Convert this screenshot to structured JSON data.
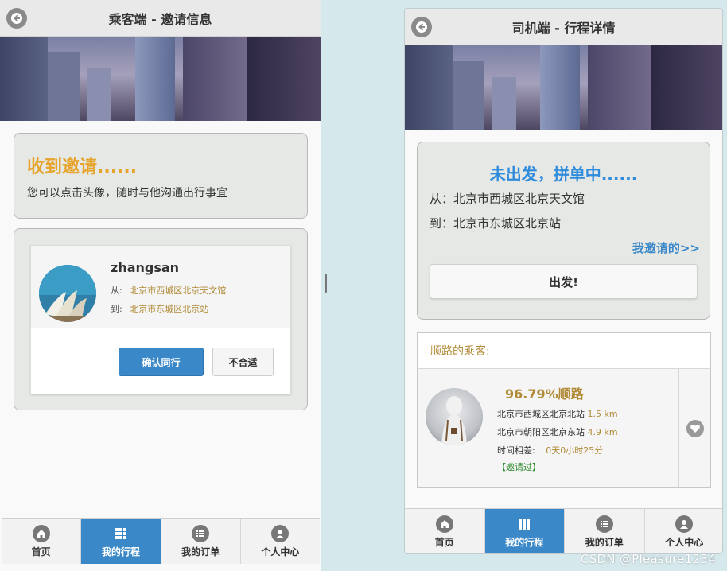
{
  "left": {
    "title": "乘客端 - 邀请信息",
    "invite_title": "收到邀请......",
    "invite_sub": "您可以点击头像，随时与他沟通出行事宜",
    "user": {
      "name": "zhangsan",
      "from_label": "从:",
      "from_addr": "北京市西城区北京天文馆",
      "to_label": "到:",
      "to_addr": "北京市东城区北京站"
    },
    "confirm_btn": "确认同行",
    "reject_btn": "不合适"
  },
  "right": {
    "title": "司机端 - 行程详情",
    "status": "未出发，拼单中......",
    "from": "从：北京市西城区北京天文馆",
    "to": "到：北京市东城区北京站",
    "invited_link": "我邀请的>>",
    "depart_btn": "出发!",
    "passengers_header": "顺路的乘客:",
    "passenger": {
      "match": "96.79%顺路",
      "from_addr": "北京市西城区北京北站",
      "from_dist": "1.5 km",
      "to_addr": "北京市朝阳区北京东站",
      "to_dist": "4.9 km",
      "time_label": "时间相差:",
      "time_value": "0天0小时25分",
      "tag": "【邀请过】"
    }
  },
  "tabs": [
    {
      "label": "首页",
      "icon": "home-icon"
    },
    {
      "label": "我的行程",
      "icon": "grid-icon"
    },
    {
      "label": "我的订单",
      "icon": "list-icon"
    },
    {
      "label": "个人中心",
      "icon": "user-icon"
    }
  ],
  "active_tab": "我的行程",
  "colors": {
    "accent_blue": "#3b88c8",
    "status_blue": "#2f8bdc",
    "gold": "#e7a42c",
    "tan": "#b08a36",
    "green": "#2e8b2e"
  },
  "watermark": "CSDN @Pleasure1234"
}
